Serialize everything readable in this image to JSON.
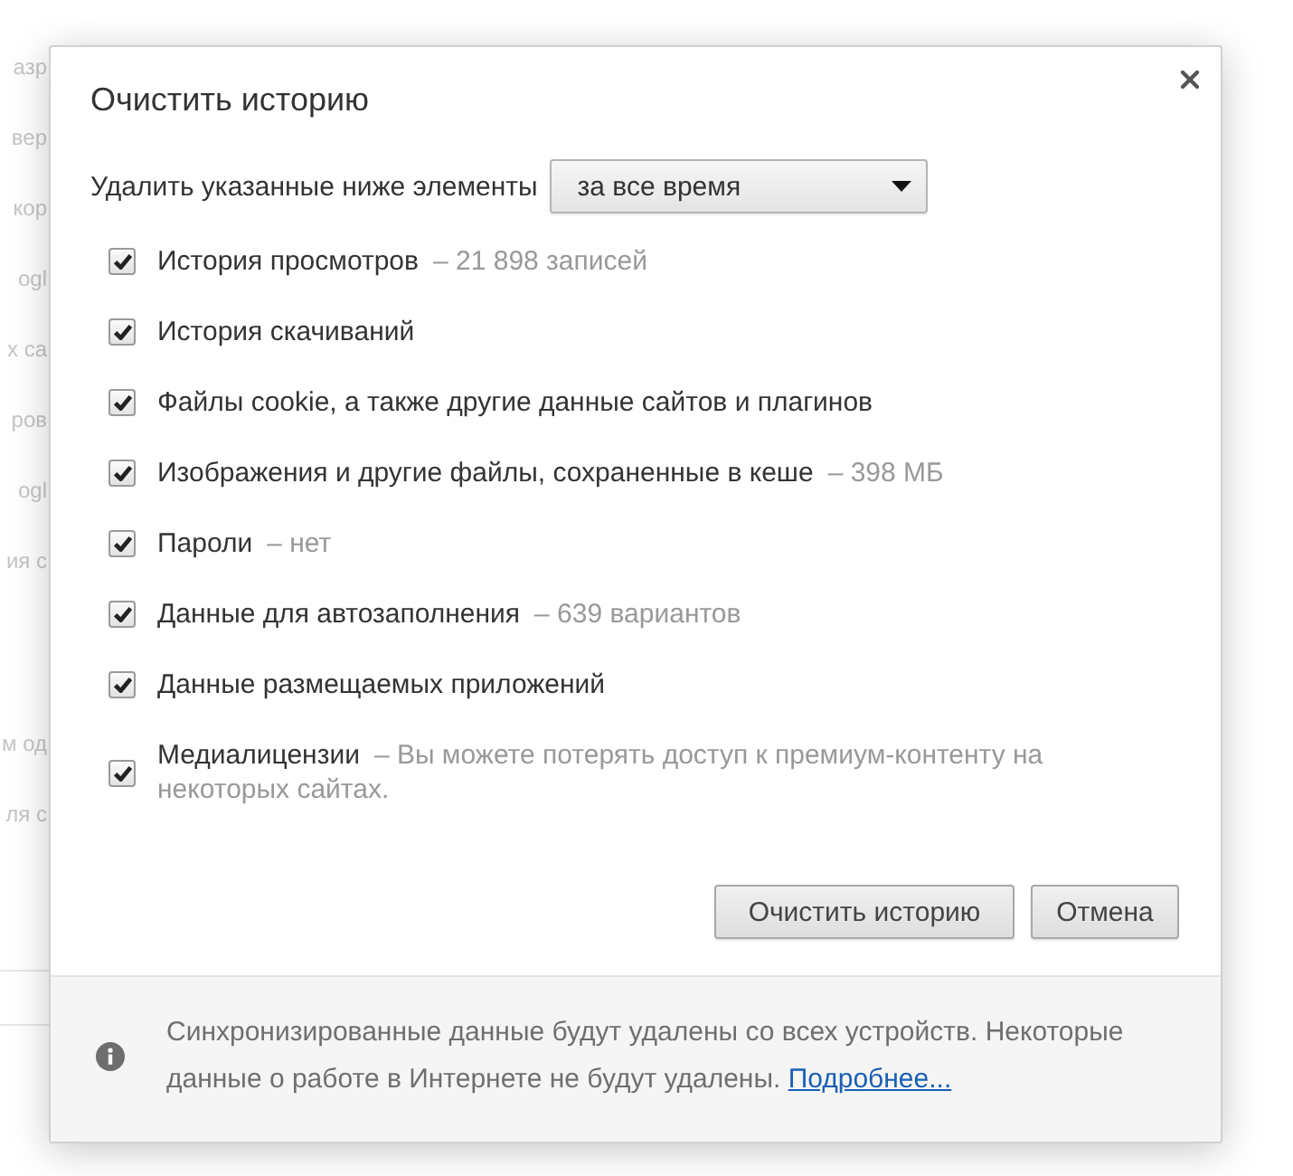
{
  "background_page": {
    "fragments": [
      "азр",
      "вер",
      "кор",
      "ogl",
      "х са",
      "ров",
      "ogl",
      "ия с",
      "м од",
      "ля с"
    ]
  },
  "dialog": {
    "title": "Очистить историю",
    "period": {
      "label": "Удалить указанные ниже элементы",
      "value": "за все время"
    },
    "items": [
      {
        "label": "История просмотров",
        "detail": "– 21 898 записей",
        "checked": true
      },
      {
        "label": "История скачиваний",
        "checked": true
      },
      {
        "label": "Файлы cookie, а также другие данные сайтов и плагинов",
        "checked": true
      },
      {
        "label": "Изображения и другие файлы, сохраненные в кеше",
        "detail": "– 398 МБ",
        "checked": true
      },
      {
        "label": "Пароли",
        "detail": "– нет",
        "checked": true
      },
      {
        "label": "Данные для автозаполнения",
        "detail": "– 639 вариантов",
        "checked": true
      },
      {
        "label": "Данные размещаемых приложений",
        "checked": true
      },
      {
        "label": "Медиалицензии",
        "detail": "– Вы можете потерять доступ к премиум-контенту на некоторых сайтах.",
        "checked": true
      }
    ],
    "buttons": [
      "Очистить историю",
      "Отмена"
    ],
    "footer": {
      "text": "Синхронизированные данные будут удалены со всех устройств. Некоторые данные о работе в Интернете не будут удалены.",
      "link": "Подробнее..."
    }
  }
}
